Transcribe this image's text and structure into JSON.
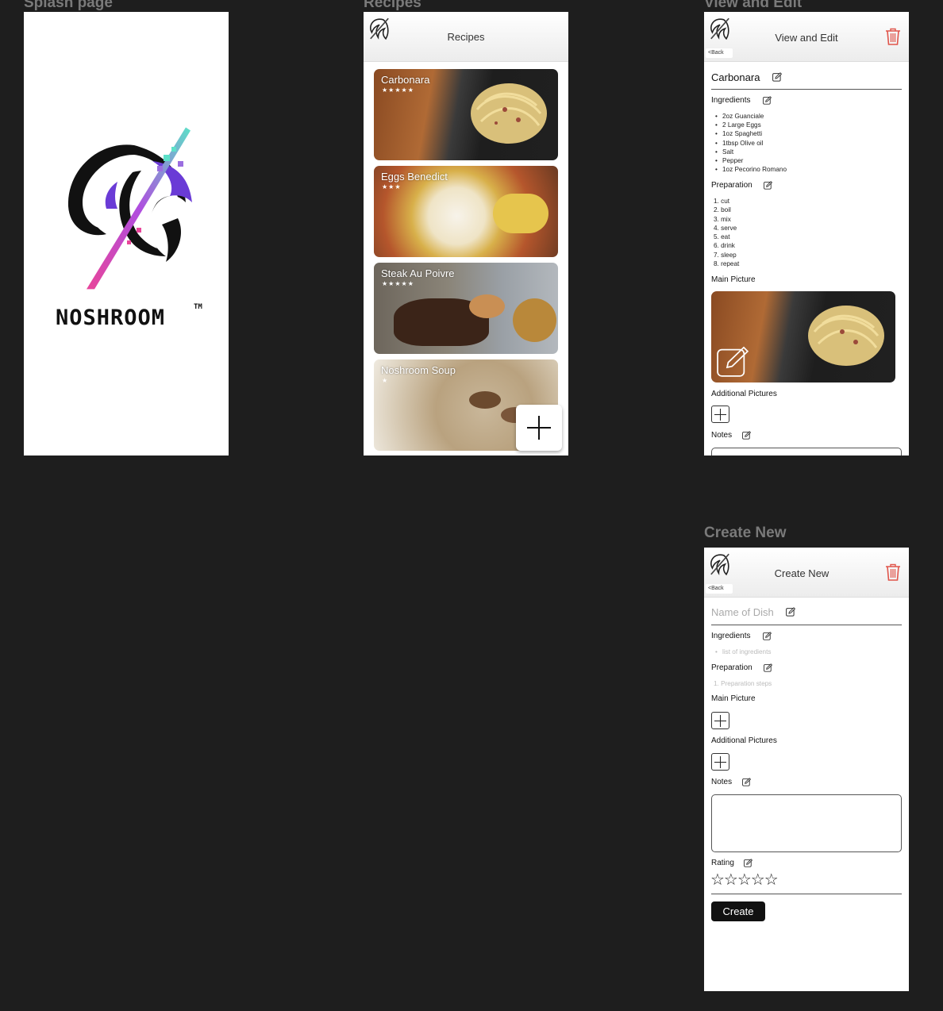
{
  "frames": {
    "splash": {
      "label": "Splash page",
      "brand": "NOSHROOM",
      "tm": "TM"
    },
    "recipes": {
      "label": "Recipes",
      "title": "Recipes",
      "cards": [
        {
          "name": "Carbonara",
          "stars": "★★★★★",
          "rating": 5
        },
        {
          "name": "Eggs Benedict",
          "stars": "★★★",
          "rating": 3
        },
        {
          "name": "Steak Au Poivre",
          "stars": "★★★★★",
          "rating": 5
        },
        {
          "name": "Noshroom Soup",
          "stars": "★",
          "rating": 1
        }
      ]
    },
    "view_edit": {
      "label": "View and Edit",
      "title": "View and Edit",
      "back": "<Back",
      "dish_name": "Carbonara",
      "ingredients_label": "Ingredients",
      "ingredients": [
        "2oz Guanciale",
        "2 Large Eggs",
        "1oz Spaghetti",
        "1tbsp Olive oil",
        "Salt",
        "Pepper",
        "1oz Pecorino Romano"
      ],
      "preparation_label": "Preparation",
      "steps": [
        "1. cut",
        "2. boil",
        "3. mix",
        "4. serve",
        "5. eat",
        "6. drink",
        "7. sleep",
        "8. repeat"
      ],
      "main_picture_label": "Main Picture",
      "additional_label": "Additional Pictures",
      "notes_label": "Notes"
    },
    "create_new": {
      "label": "Create New",
      "title": "Create New",
      "back": "<Back",
      "name_placeholder": "Name of Dish",
      "ingredients_label": "Ingredients",
      "ingredients_placeholder": "list of ingredients",
      "preparation_label": "Preparation",
      "preparation_placeholder": "1. Preparation steps",
      "main_picture_label": "Main Picture",
      "additional_label": "Additional Pictures",
      "notes_label": "Notes",
      "rating_label": "Rating",
      "rating_stars": "☆☆☆☆☆",
      "create_button": "Create"
    }
  },
  "colors": {
    "canvas": "#1e1e1e",
    "accent_red": "#e0554b",
    "button": "#111111"
  }
}
